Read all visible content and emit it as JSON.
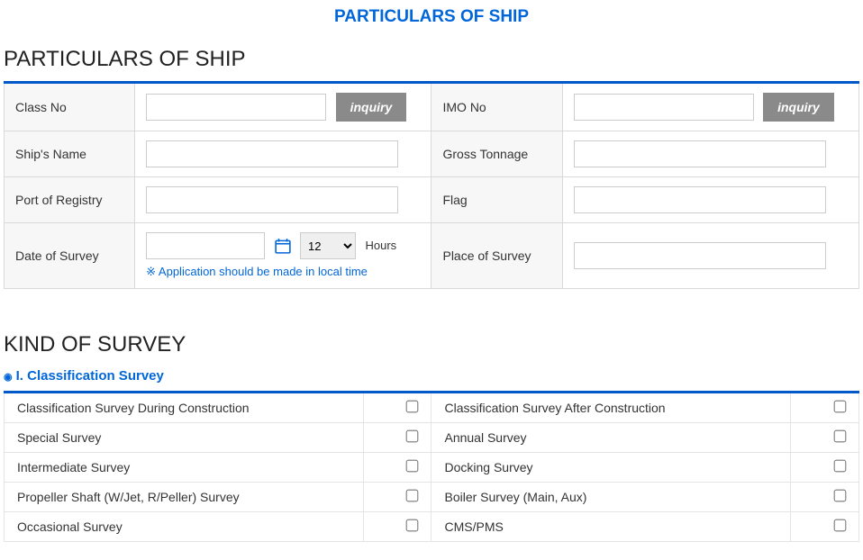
{
  "page_title": "PARTICULARS OF SHIP",
  "section1": {
    "heading": "PARTICULARS OF SHIP",
    "labels": {
      "class_no": "Class No",
      "imo_no": "IMO No",
      "ship_name": "Ship's Name",
      "gross_tonnage": "Gross Tonnage",
      "port_of_registry": "Port of Registry",
      "flag": "Flag",
      "date_of_survey": "Date of Survey",
      "place_of_survey": "Place of Survey"
    },
    "values": {
      "class_no": "",
      "imo_no": "",
      "ship_name": "",
      "gross_tonnage": "",
      "port_of_registry": "",
      "flag": "",
      "date_of_survey": "",
      "place_of_survey": "",
      "hours": "12"
    },
    "inquiry_label": "inquiry",
    "hours_unit": "Hours",
    "note": "※ Application should be made in local time"
  },
  "section2": {
    "heading": "KIND OF SURVEY",
    "subheading": "I. Classification Survey",
    "items": [
      {
        "left": "Classification Survey During Construction",
        "right": "Classification Survey After Construction"
      },
      {
        "left": "Special Survey",
        "right": "Annual Survey"
      },
      {
        "left": "Intermediate Survey",
        "right": "Docking Survey"
      },
      {
        "left": "Propeller Shaft (W/Jet, R/Peller) Survey",
        "right": "Boiler Survey (Main, Aux)"
      },
      {
        "left": "Occasional Survey",
        "right": "CMS/PMS"
      }
    ]
  }
}
